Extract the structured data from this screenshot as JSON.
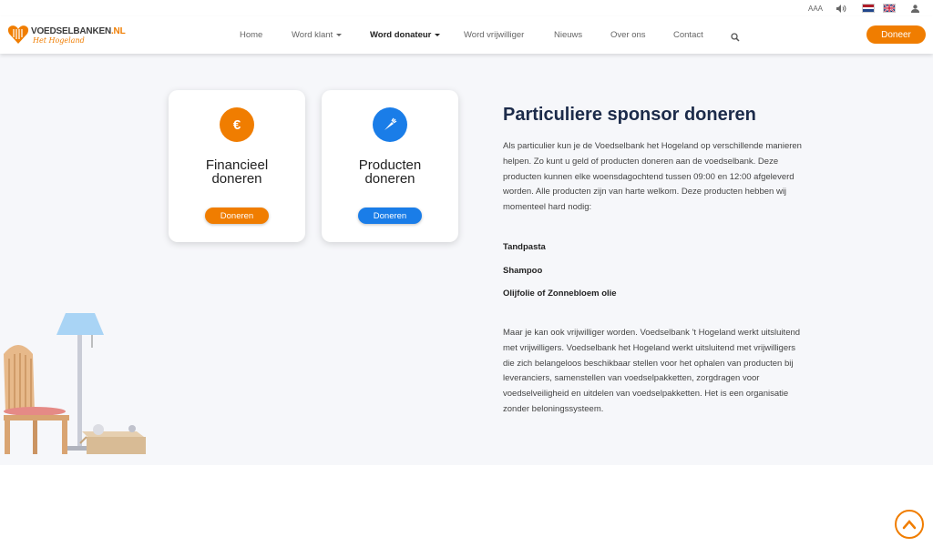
{
  "topbar": {
    "text_size_label": "AAA",
    "speaker_icon": "speaker-icon",
    "languages": [
      "NL",
      "EN"
    ],
    "user_icon": "user-icon"
  },
  "header": {
    "logo_name": "VOEDSELBANKEN",
    "logo_suffix": ".NL",
    "logo_sub": "Het Hogeland",
    "nav": [
      {
        "label": "Home"
      },
      {
        "label": "Word klant"
      },
      {
        "label": "Word donateur"
      },
      {
        "label": "Word vrijwilliger"
      },
      {
        "label": "Nieuws"
      },
      {
        "label": "Over ons"
      },
      {
        "label": "Contact"
      }
    ],
    "cta": "Doneer"
  },
  "cards": [
    {
      "icon": "€",
      "title_line1": "Financieel",
      "title_line2": "doneren",
      "button": "Doneren",
      "color": "#f07d00"
    },
    {
      "icon": "carrot-icon",
      "title_line1": "Producten",
      "title_line2": "doneren",
      "button": "Doneren",
      "color": "#1a7de8"
    }
  ],
  "content": {
    "title": "Particuliere sponsor doneren",
    "intro": "Als particulier kun je de Voedselbank het Hogeland op verschillende manieren helpen. Zo kunt u geld of producten doneren aan de voedselbank. Deze producten kunnen elke woensdagochtend tussen 09:00 en 12:00 afgeleverd worden. Alle producten zijn van harte welkom. Deze producten hebben wij momenteel hard nodig:",
    "needed": [
      "Tandpasta",
      "Shampoo",
      "Olijfolie of Zonnebloem olie"
    ],
    "outro": "Maar je kan ook vrijwilliger worden. Voedselbank 't Hogeland werkt uitsluitend met vrijwilligers. Voedselbank het Hogeland werkt uitsluitend met vrijwilligers die zich belangeloos beschikbaar stellen voor het ophalen van producten bij leveranciers, samenstellen van voedselpakketten, zorgdragen voor voedselveiligheid en uitdelen van voedselpakketten. Het is een organisatie zonder beloningssysteem."
  },
  "colors": {
    "accent": "#f07d00",
    "blue": "#1a7de8",
    "heading": "#1c2b4a",
    "bg": "#f6f7fa"
  }
}
